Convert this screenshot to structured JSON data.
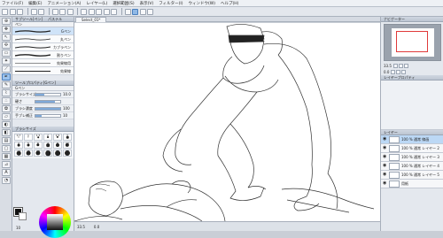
{
  "menu": [
    "ファイル(F)",
    "編集(E)",
    "アニメーション(A)",
    "レイヤー(L)",
    "選択範囲(S)",
    "表示(V)",
    "フィルター(I)",
    "ウィンドウ(W)",
    "ヘルプ(H)"
  ],
  "document_tab": "Select_01*",
  "left_panel": {
    "subtool_title": "サブツール[ペン]",
    "subtool_tab2": "パステル",
    "pen_group": "ペン",
    "brushes": [
      {
        "label": "Gペン"
      },
      {
        "label": "丸ペン"
      },
      {
        "label": "カブラペン"
      },
      {
        "label": "割りペン"
      },
      {
        "label": "効果線用"
      },
      {
        "label": "効果線"
      }
    ],
    "props_title": "ツールプロパティ[Gペン]",
    "props_sub": "Gペン",
    "properties": [
      {
        "label": "ブラシサイズ",
        "value": "10.0",
        "level": 0.35
      },
      {
        "label": "硬さ",
        "value": "",
        "level": 0.8
      },
      {
        "label": "ブラシ濃度",
        "value": "100",
        "level": 1.0
      },
      {
        "label": "手ブレ補正",
        "value": "10",
        "level": 0.25
      }
    ],
    "tips_title": "ブラシサイズ",
    "tips": [
      "0.7",
      "1",
      "1.5",
      "2",
      "2.5",
      "3",
      "4",
      "5",
      "6",
      "7",
      "8",
      "10",
      "12",
      "15",
      "17",
      "20",
      "25",
      "30"
    ],
    "color_value": "10"
  },
  "right_panel": {
    "nav_title": "ナビゲーター",
    "zoom": "33.5",
    "angle": "0.0",
    "props_title": "レイヤープロパティ",
    "layers_title": "レイヤー",
    "layers": [
      {
        "name": "100 % 通常 線画"
      },
      {
        "name": "100 % 通常 レイヤー 2"
      },
      {
        "name": "100 % 通常 レイヤー 3"
      },
      {
        "name": "100 % 通常 レイヤー 4"
      },
      {
        "name": "100 % 通常 レイヤー 5"
      },
      {
        "name": "用紙"
      }
    ]
  },
  "status": {
    "zoom": "33.5",
    "angle": "0.0"
  },
  "colors": {
    "accent": "#4a7fbd",
    "selected_row": "#bcd8f5",
    "nav_frame": "#e03b3b"
  }
}
